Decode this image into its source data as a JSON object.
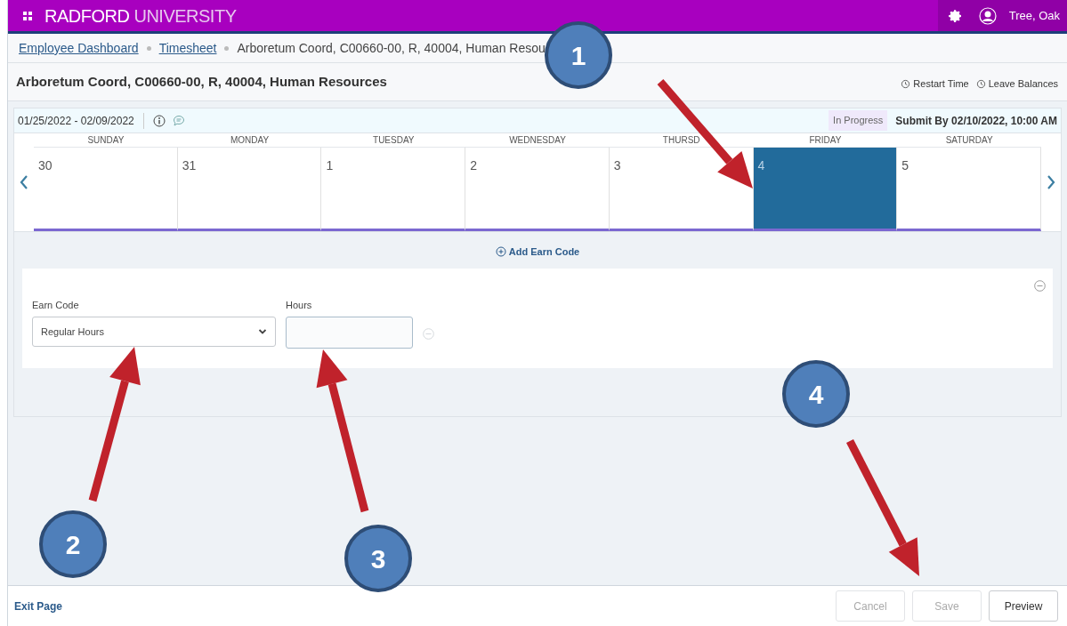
{
  "header": {
    "brand_bold": "RADFORD",
    "brand_light": "UNIVERSITY",
    "user": "Tree, Oak"
  },
  "breadcrumbs": [
    {
      "label": "Employee Dashboard",
      "kind": "link"
    },
    {
      "label": "Timesheet",
      "kind": "link"
    },
    {
      "label": "Arboretum Coord, C00660-00, R, 40004, Human Resou",
      "kind": "current"
    }
  ],
  "page_title": "Arboretum Coord, C00660-00, R, 40004, Human Resources",
  "actions": [
    "Restart Time",
    "Leave Balances"
  ],
  "period": {
    "range": "01/25/2022 - 02/09/2022",
    "status": "In Progress",
    "submit_by": "Submit By 02/10/2022, 10:00 AM"
  },
  "days": [
    {
      "weekday": "SUNDAY",
      "date": "30",
      "selected": false
    },
    {
      "weekday": "MONDAY",
      "date": "31",
      "selected": false
    },
    {
      "weekday": "TUESDAY",
      "date": "1",
      "selected": false
    },
    {
      "weekday": "WEDNESDAY",
      "date": "2",
      "selected": false
    },
    {
      "weekday": "THURSD",
      "date": "3",
      "selected": false
    },
    {
      "weekday": "FRIDAY",
      "date": "4",
      "selected": true
    },
    {
      "weekday": "SATURDAY",
      "date": "5",
      "selected": false
    }
  ],
  "add_earn_code": "Add Earn Code",
  "entry": {
    "earn_code_label": "Earn Code",
    "earn_code_value": "Regular Hours",
    "hours_label": "Hours"
  },
  "footer": {
    "exit": "Exit Page",
    "buttons": [
      {
        "label": "Cancel",
        "disabled": true
      },
      {
        "label": "Save",
        "disabled": true
      },
      {
        "label": "Preview",
        "disabled": false
      }
    ]
  },
  "callouts": [
    "1",
    "2",
    "3",
    "4"
  ]
}
